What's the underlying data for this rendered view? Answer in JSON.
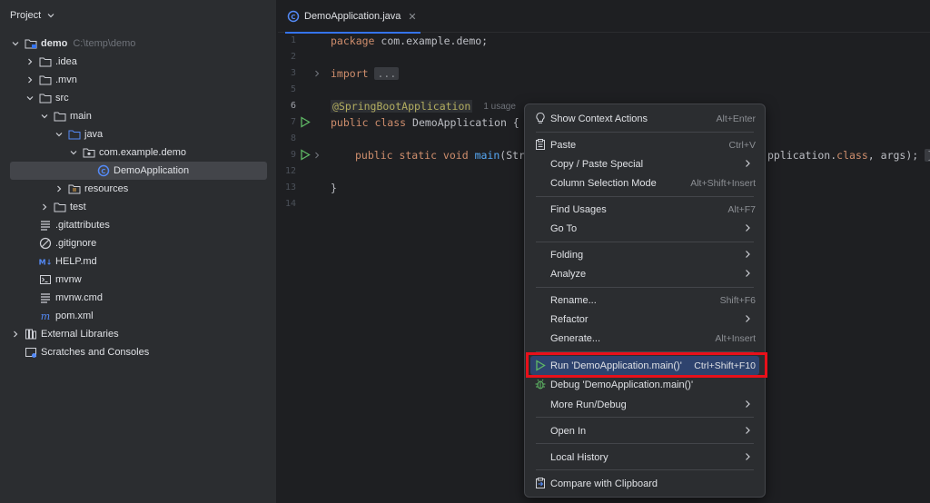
{
  "project_panel": {
    "title": "Project",
    "tree": [
      {
        "label": "demo",
        "hint": "C:\\temp\\demo"
      },
      {
        "label": ".idea"
      },
      {
        "label": ".mvn"
      },
      {
        "label": "src"
      },
      {
        "label": "main"
      },
      {
        "label": "java"
      },
      {
        "label": "com.example.demo"
      },
      {
        "label": "DemoApplication"
      },
      {
        "label": "resources"
      },
      {
        "label": "test"
      },
      {
        "label": ".gitattributes"
      },
      {
        "label": ".gitignore"
      },
      {
        "label": "HELP.md"
      },
      {
        "label": "mvnw"
      },
      {
        "label": "mvnw.cmd"
      },
      {
        "label": "pom.xml"
      },
      {
        "label": "External Libraries"
      },
      {
        "label": "Scratches and Consoles"
      }
    ]
  },
  "editor": {
    "tab_label": "DemoApplication.java",
    "line_numbers": [
      "1",
      "2",
      "3",
      "5",
      "6",
      "7",
      "8",
      "9",
      "12",
      "13",
      "14"
    ],
    "code": {
      "l1_kw": "package",
      "l1_rest": " com.example.demo;",
      "l3_kw": "import",
      "l3_fold": "...",
      "l6_ann": "@SpringBootApplication",
      "l6_usage": "1 usage",
      "l7_kw": "public class",
      "l7_rest": " DemoApplication {",
      "l9_kw": "public static void",
      "l9_fn": "main",
      "l9_rest": "(Stri",
      "l9_tail_a": "pplication.",
      "l9_tail_kw": "class",
      "l9_tail_b": ", args);",
      "l9_fold": "}",
      "l13": "}"
    }
  },
  "context_menu": {
    "items": [
      {
        "label": "Show Context Actions",
        "shortcut": "Alt+Enter"
      },
      {
        "label": "Paste",
        "shortcut": "Ctrl+V"
      },
      {
        "label": "Copy / Paste Special"
      },
      {
        "label": "Column Selection Mode",
        "shortcut": "Alt+Shift+Insert"
      },
      {
        "label": "Find Usages",
        "shortcut": "Alt+F7"
      },
      {
        "label": "Go To"
      },
      {
        "label": "Folding"
      },
      {
        "label": "Analyze"
      },
      {
        "label": "Rename...",
        "shortcut": "Shift+F6"
      },
      {
        "label": "Refactor"
      },
      {
        "label": "Generate...",
        "shortcut": "Alt+Insert"
      },
      {
        "label": "Run 'DemoApplication.main()'",
        "shortcut": "Ctrl+Shift+F10"
      },
      {
        "label": "Debug 'DemoApplication.main()'"
      },
      {
        "label": "More Run/Debug"
      },
      {
        "label": "Open In"
      },
      {
        "label": "Local History"
      },
      {
        "label": "Compare with Clipboard"
      }
    ]
  },
  "colors": {
    "selection_highlight": "#e8101a",
    "run_green": "#5fb865",
    "accent": "#3574f0"
  }
}
